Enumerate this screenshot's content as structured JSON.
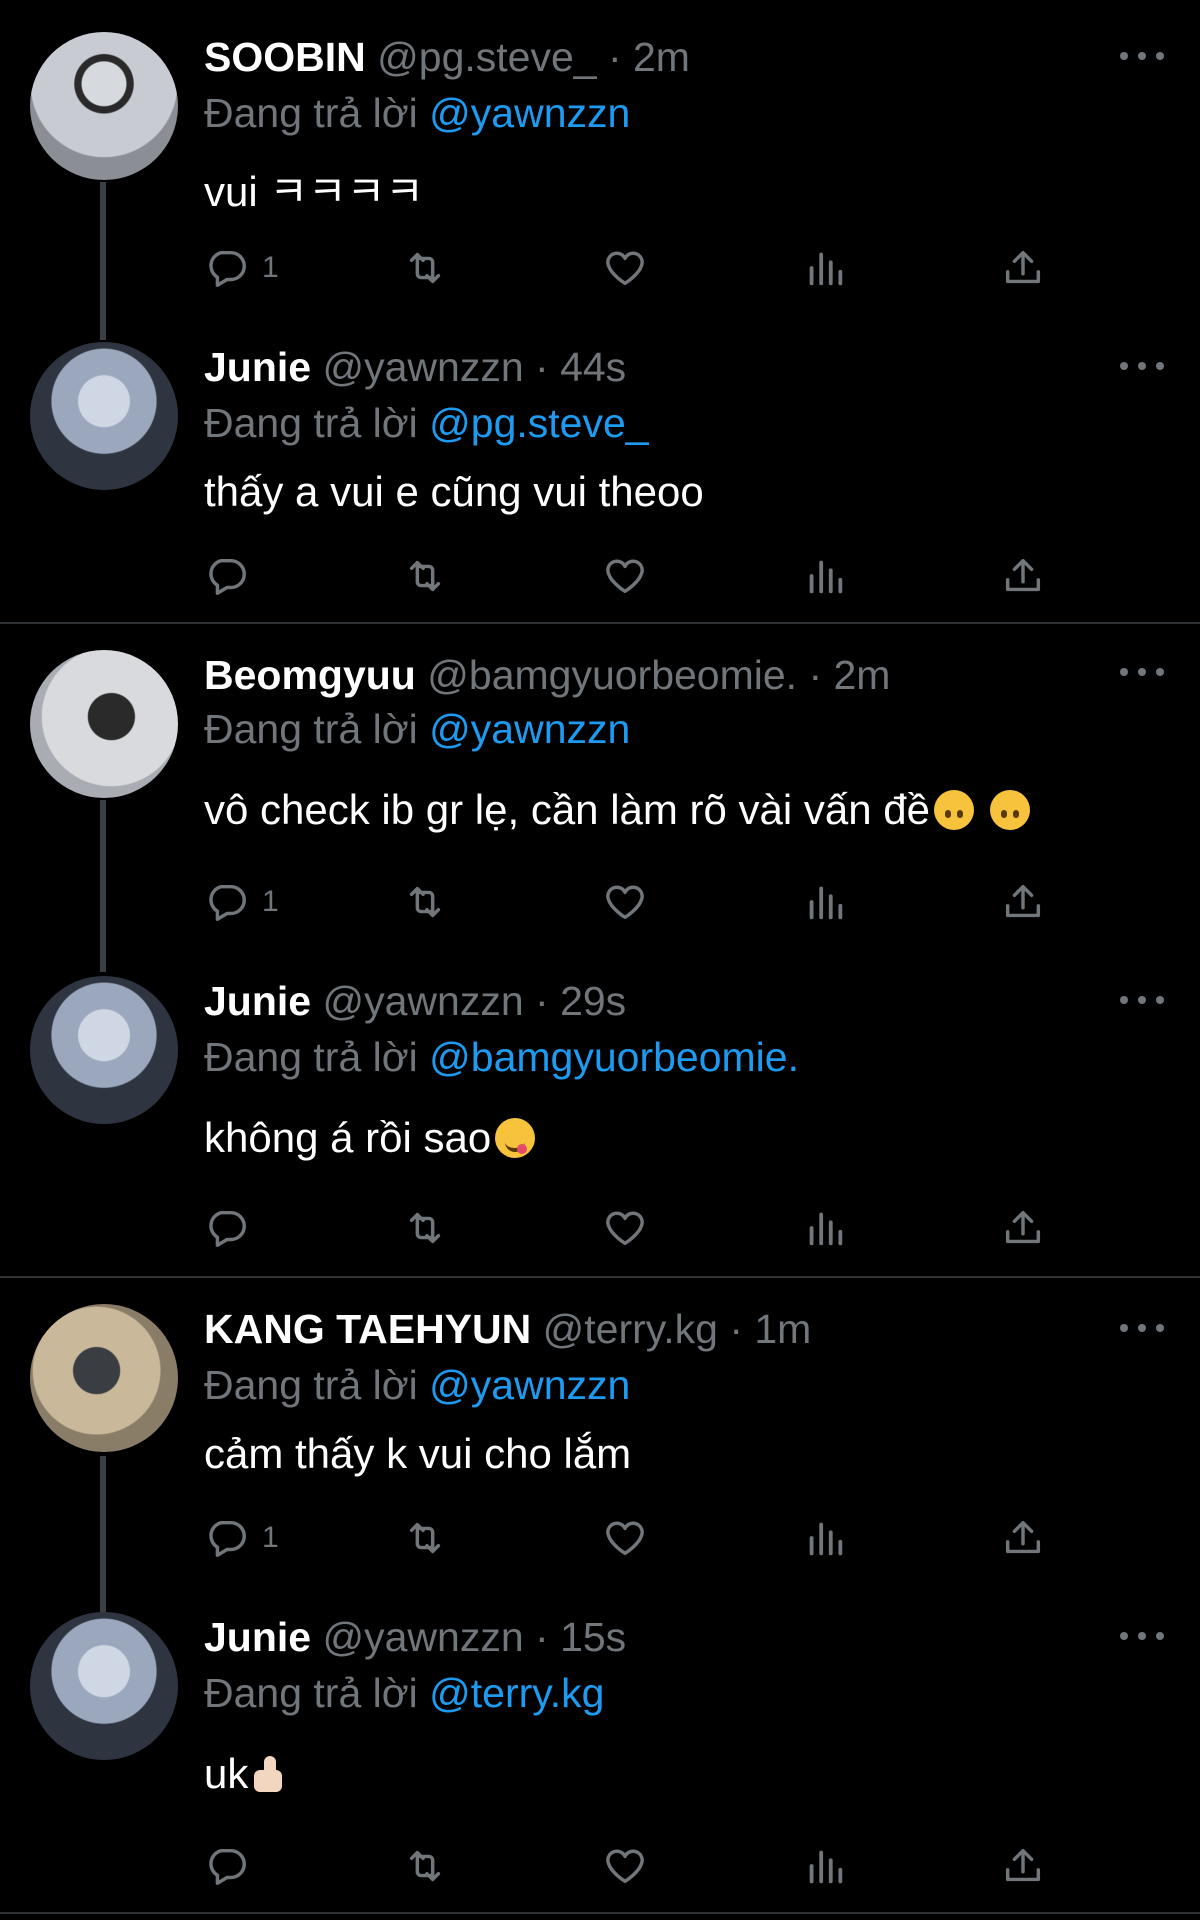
{
  "reply_prefix": "Đang trả lời",
  "colors": {
    "background": "#000000",
    "muted": "#71767b",
    "link": "#1d9bf0",
    "divider": "#2f3336"
  },
  "icons": [
    "reply-icon",
    "retweet-icon",
    "like-icon",
    "views-icon",
    "share-icon",
    "more-icon"
  ],
  "tweets": [
    {
      "name": "SOOBIN",
      "meta": "@pg.steve_ · 2m",
      "reply_to": "@yawnzzn",
      "text": "vui ㅋㅋㅋㅋ",
      "reply_count": "1"
    },
    {
      "name": "Junie",
      "meta": "@yawnzzn · 44s",
      "reply_to": "@pg.steve_",
      "text": "thấy a vui e cũng vui theoo",
      "reply_count": ""
    },
    {
      "name": "Beomgyuu",
      "meta": "@bamgyuorbeomie. · 2m",
      "reply_to": "@yawnzzn",
      "text": "vô check ib gr lẹ, cần làm rõ vài vấn đề",
      "reply_count": "1"
    },
    {
      "name": "Junie",
      "meta": "@yawnzzn · 29s",
      "reply_to": "@bamgyuorbeomie.",
      "text": "không á rồi sao",
      "reply_count": ""
    },
    {
      "name": "KANG TAEHYUN",
      "meta": "@terry.kg · 1m",
      "reply_to": "@yawnzzn",
      "text": "cảm thấy k vui cho lắm",
      "reply_count": "1"
    },
    {
      "name": "Junie",
      "meta": "@yawnzzn · 15s",
      "reply_to": "@terry.kg",
      "text": "uk",
      "reply_count": ""
    }
  ]
}
